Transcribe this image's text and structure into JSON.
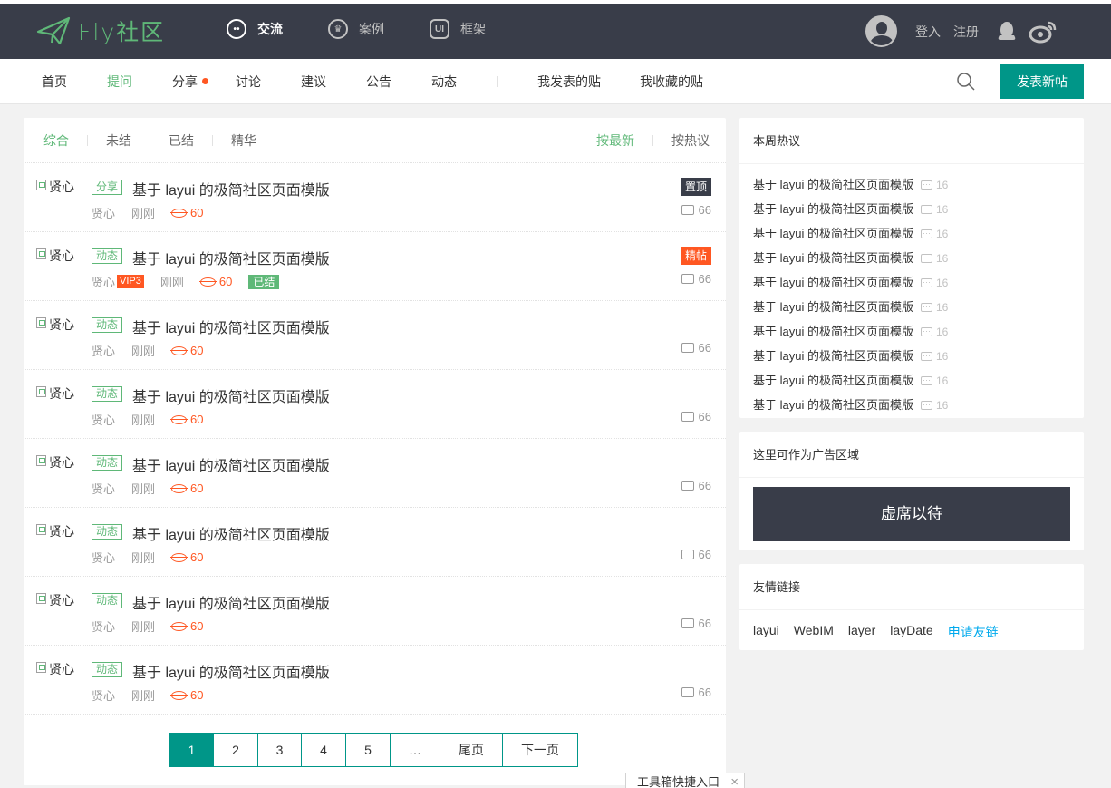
{
  "brand": {
    "logo_text": "Fly社区",
    "accent_color": "#5fb878",
    "header_bg": "#393d49",
    "primary_color": "#009688"
  },
  "top_nav": [
    {
      "label": "交流",
      "icon": "chat-icon",
      "active": true
    },
    {
      "label": "案例",
      "icon": "crown-icon",
      "active": false
    },
    {
      "label": "框架",
      "icon": "ui-icon",
      "active": false
    }
  ],
  "user_area": {
    "login": "登入",
    "register": "注册",
    "qq_icon": "qq-icon",
    "weibo_icon": "weibo-icon"
  },
  "sub_nav": {
    "items": [
      "首页",
      "提问",
      "分享",
      "讨论",
      "建议",
      "公告",
      "动态"
    ],
    "active": "提问",
    "mine": [
      "我发表的贴",
      "我收藏的贴"
    ],
    "new_post": "发表新帖"
  },
  "filters": {
    "tabs": [
      "综合",
      "未结",
      "已结",
      "精华"
    ],
    "sort": [
      "按最新",
      "按热议"
    ]
  },
  "posts": [
    {
      "avatar_alt": "贤心",
      "category": "分享",
      "title": "基于 layui 的极简社区页面模版",
      "author": "贤心",
      "vip": "",
      "time": "刚刚",
      "views": "60",
      "solved": "",
      "badge": "置顶",
      "badge_type": "top",
      "replies": "66"
    },
    {
      "avatar_alt": "贤心",
      "category": "动态",
      "title": "基于 layui 的极简社区页面模版",
      "author": "贤心",
      "vip": "VIP3",
      "time": "刚刚",
      "views": "60",
      "solved": "已结",
      "badge": "精帖",
      "badge_type": "fine",
      "replies": "66"
    },
    {
      "avatar_alt": "贤心",
      "category": "动态",
      "title": "基于 layui 的极简社区页面模版",
      "author": "贤心",
      "vip": "",
      "time": "刚刚",
      "views": "60",
      "solved": "",
      "badge": "",
      "badge_type": "",
      "replies": "66"
    },
    {
      "avatar_alt": "贤心",
      "category": "动态",
      "title": "基于 layui 的极简社区页面模版",
      "author": "贤心",
      "vip": "",
      "time": "刚刚",
      "views": "60",
      "solved": "",
      "badge": "",
      "badge_type": "",
      "replies": "66"
    },
    {
      "avatar_alt": "贤心",
      "category": "动态",
      "title": "基于 layui 的极简社区页面模版",
      "author": "贤心",
      "vip": "",
      "time": "刚刚",
      "views": "60",
      "solved": "",
      "badge": "",
      "badge_type": "",
      "replies": "66"
    },
    {
      "avatar_alt": "贤心",
      "category": "动态",
      "title": "基于 layui 的极简社区页面模版",
      "author": "贤心",
      "vip": "",
      "time": "刚刚",
      "views": "60",
      "solved": "",
      "badge": "",
      "badge_type": "",
      "replies": "66"
    },
    {
      "avatar_alt": "贤心",
      "category": "动态",
      "title": "基于 layui 的极简社区页面模版",
      "author": "贤心",
      "vip": "",
      "time": "刚刚",
      "views": "60",
      "solved": "",
      "badge": "",
      "badge_type": "",
      "replies": "66"
    },
    {
      "avatar_alt": "贤心",
      "category": "动态",
      "title": "基于 layui 的极简社区页面模版",
      "author": "贤心",
      "vip": "",
      "time": "刚刚",
      "views": "60",
      "solved": "",
      "badge": "",
      "badge_type": "",
      "replies": "66"
    }
  ],
  "pager": {
    "pages": [
      "1",
      "2",
      "3",
      "4",
      "5",
      "…",
      "尾页",
      "下一页"
    ],
    "current": "1"
  },
  "sidebar": {
    "hot_title": "本周热议",
    "hot_items": [
      {
        "title": "基于 layui 的极简社区页面模版",
        "count": "16"
      },
      {
        "title": "基于 layui 的极简社区页面模版",
        "count": "16"
      },
      {
        "title": "基于 layui 的极简社区页面模版",
        "count": "16"
      },
      {
        "title": "基于 layui 的极简社区页面模版",
        "count": "16"
      },
      {
        "title": "基于 layui 的极简社区页面模版",
        "count": "16"
      },
      {
        "title": "基于 layui 的极简社区页面模版",
        "count": "16"
      },
      {
        "title": "基于 layui 的极简社区页面模版",
        "count": "16"
      },
      {
        "title": "基于 layui 的极简社区页面模版",
        "count": "16"
      },
      {
        "title": "基于 layui 的极简社区页面模版",
        "count": "16"
      },
      {
        "title": "基于 layui 的极简社区页面模版",
        "count": "16"
      }
    ],
    "ad_title": "这里可作为广告区域",
    "ad_text": "虚席以待",
    "links_title": "友情链接",
    "links": [
      "layui",
      "WebIM",
      "layer",
      "layDate"
    ],
    "apply_link": "申请友链"
  },
  "toolbox": {
    "label": "工具箱快捷入口",
    "close": "×"
  }
}
